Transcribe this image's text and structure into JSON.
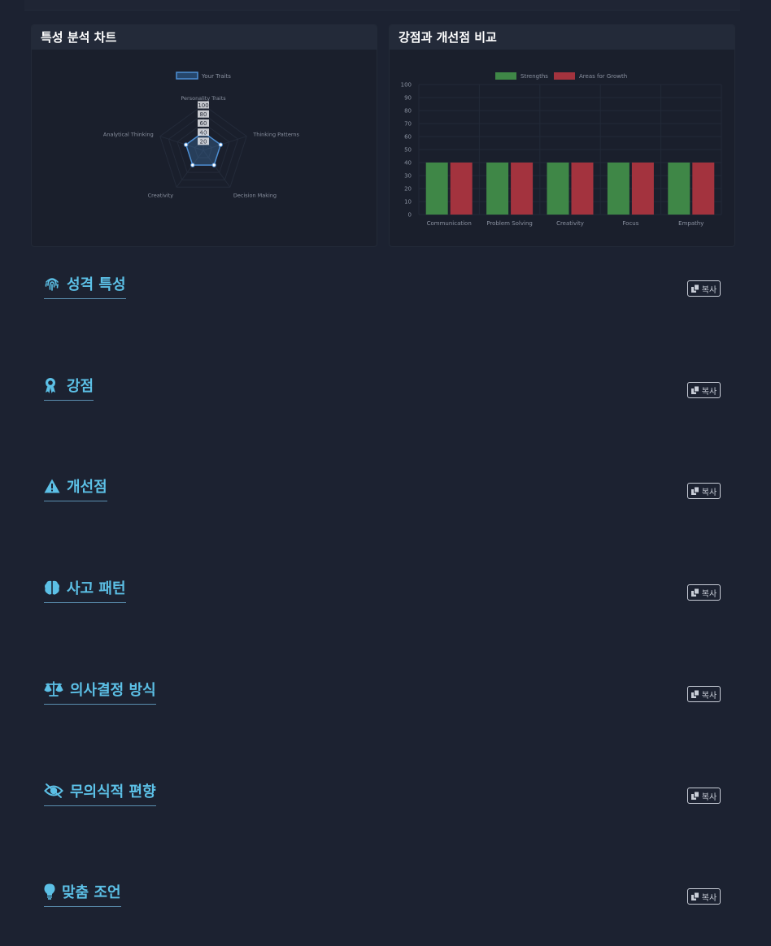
{
  "cards": {
    "radar_title": "특성 분석 차트",
    "bar_title": "강점과 개선점 비교"
  },
  "chart_data": [
    {
      "type": "radar",
      "title": "Personality Traits",
      "legend": [
        "Your Traits"
      ],
      "legend_position": "top",
      "axes": [
        "Personality Traits",
        "Thinking Patterns",
        "Decision Making",
        "Creativity",
        "Analytical Thinking"
      ],
      "ticks": [
        "20",
        "40",
        "60",
        "80",
        "100"
      ],
      "range": [
        0,
        100
      ],
      "series": [
        {
          "name": "Your Traits",
          "values": [
            40,
            40,
            40,
            40,
            40
          ],
          "color": "#4d8fd4"
        }
      ]
    },
    {
      "type": "bar",
      "categories": [
        "Communication",
        "Problem Solving",
        "Creativity",
        "Focus",
        "Empathy"
      ],
      "ylim": [
        0,
        100
      ],
      "yticks": [
        "0",
        "10",
        "20",
        "30",
        "40",
        "50",
        "60",
        "70",
        "80",
        "90",
        "100"
      ],
      "legend_position": "top",
      "grid": true,
      "series": [
        {
          "name": "Strengths",
          "values": [
            40,
            40,
            40,
            40,
            40
          ],
          "color": "#3f8747"
        },
        {
          "name": "Areas for Growth",
          "values": [
            40,
            40,
            40,
            40,
            40
          ],
          "color": "#a3333e"
        }
      ]
    }
  ],
  "sections": [
    {
      "title": "성격 특성",
      "icon": "fingerprint-icon",
      "copy": "복사"
    },
    {
      "title": "강점",
      "icon": "award-icon",
      "copy": "복사"
    },
    {
      "title": "개선점",
      "icon": "warning-icon",
      "copy": "복사"
    },
    {
      "title": "사고 패턴",
      "icon": "brain-icon",
      "copy": "복사"
    },
    {
      "title": "의사결정 방식",
      "icon": "scale-icon",
      "copy": "복사"
    },
    {
      "title": "무의식적 편향",
      "icon": "eye-slash-icon",
      "copy": "복사"
    },
    {
      "title": "맞춤 조언",
      "icon": "lightbulb-icon",
      "copy": "복사"
    }
  ],
  "colors": {
    "accent": "#5cc0e6",
    "background": "#1c2231",
    "card": "#1a1f2c"
  }
}
